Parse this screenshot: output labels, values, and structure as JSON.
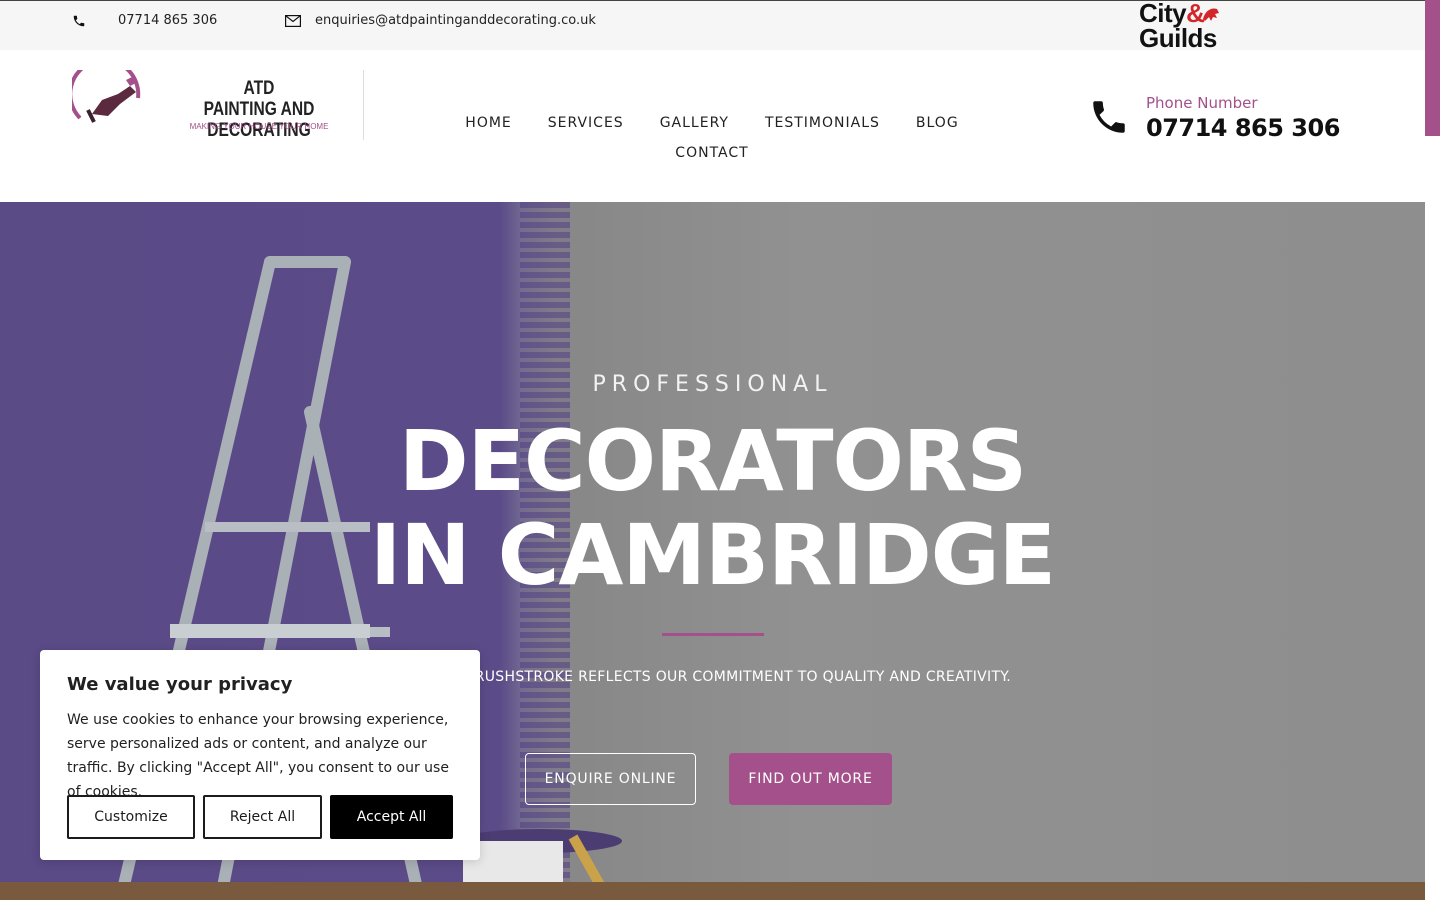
{
  "topbar": {
    "phone": "07714 865 306",
    "email": "enquiries@atdpaintinganddecorating.co.uk",
    "accreditation": {
      "line1": "City",
      "amp": "&",
      "line2": "Guilds"
    }
  },
  "header": {
    "logo": {
      "title_line1": "ATD",
      "title_line2": "PAINTING AND DECORATING",
      "tagline": "MAKING YOUR HOUSE YOUR HOME"
    },
    "nav": [
      "HOME",
      "SERVICES",
      "GALLERY",
      "TESTIMONIALS",
      "BLOG",
      "CONTACT"
    ],
    "phone_label": "Phone Number",
    "phone_number": "07714 865 306"
  },
  "hero": {
    "pretitle": "PROFESSIONAL",
    "title_line1": "DECORATORS",
    "title_line2": "IN CAMBRIDGE",
    "subtitle": "EVERY BRUSHSTROKE REFLECTS OUR COMMITMENT TO QUALITY AND CREATIVITY.",
    "btn_enquire": "ENQUIRE ONLINE",
    "btn_more": "FIND OUT MORE"
  },
  "cookie": {
    "title": "We value your privacy",
    "body": "We use cookies to enhance your browsing experience, serve personalized ads or content, and analyze our traffic. By clicking \"Accept All\", you consent to our use of cookies.",
    "customize": "Customize",
    "reject": "Reject All",
    "accept": "Accept All"
  },
  "colors": {
    "accent": "#a4508a",
    "hero_purple": "#5a4a86",
    "hero_grey": "#8e8e8e"
  },
  "icons": [
    "phone-icon",
    "envelope-icon",
    "lion-icon",
    "brush-logo-icon",
    "phone-large-icon"
  ]
}
